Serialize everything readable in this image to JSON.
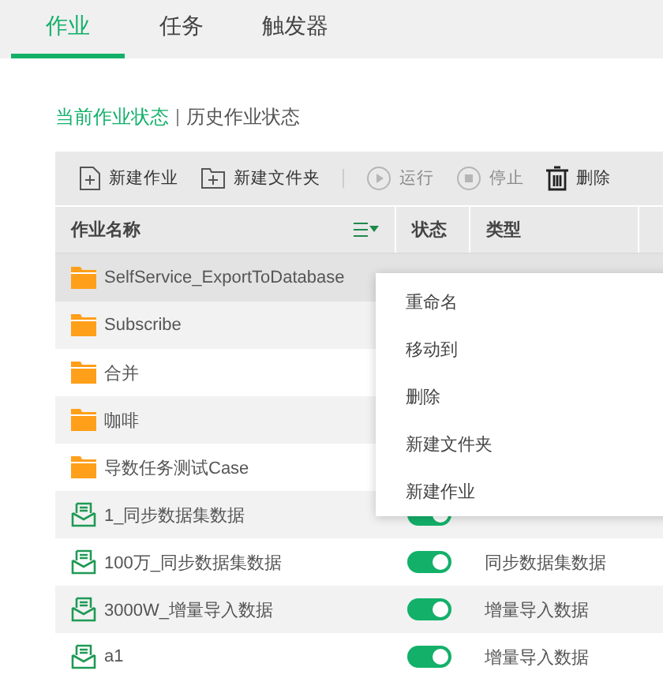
{
  "tabs": [
    {
      "label": "作业",
      "selected": true
    },
    {
      "label": "任务",
      "selected": false
    },
    {
      "label": "触发器",
      "selected": false
    }
  ],
  "subtabs": [
    {
      "label": "当前作业状态",
      "selected": true
    },
    {
      "label": "历史作业状态",
      "selected": false
    }
  ],
  "toolbar": [
    {
      "kind": "new-file",
      "label": "新建作业",
      "disabled": false
    },
    {
      "kind": "new-folder",
      "label": "新建文件夹",
      "disabled": false
    },
    {
      "kind": "separator"
    },
    {
      "kind": "run",
      "label": "运行",
      "disabled": true
    },
    {
      "kind": "stop",
      "label": "停止",
      "disabled": true
    },
    {
      "kind": "delete",
      "label": "删除",
      "disabled": false
    }
  ],
  "table": {
    "columns": [
      "作业名称",
      "状态",
      "类型"
    ],
    "rows": [
      {
        "kind": "folder",
        "name": "SelfService_ExportToDatabase",
        "selected": true
      },
      {
        "kind": "folder",
        "name": "Subscribe",
        "selected": false
      },
      {
        "kind": "folder",
        "name": "合并",
        "selected": false
      },
      {
        "kind": "folder",
        "name": "咖啡",
        "selected": false
      },
      {
        "kind": "folder",
        "name": "导数任务测试Case",
        "selected": false
      },
      {
        "kind": "job",
        "name": "1_同步数据集数据",
        "on": true,
        "selected": false
      },
      {
        "kind": "job",
        "name": "100万_同步数据集数据",
        "on": true,
        "type": "同步数据集数据",
        "selected": false
      },
      {
        "kind": "job",
        "name": "3000W_增量导入数据",
        "on": true,
        "type": "增量导入数据",
        "selected": false
      },
      {
        "kind": "job",
        "name": "a1",
        "on": true,
        "type": "增量导入数据",
        "selected": false
      }
    ]
  },
  "context_menu": [
    "重命名",
    "移动到",
    "删除",
    "新建文件夹",
    "新建作业"
  ]
}
